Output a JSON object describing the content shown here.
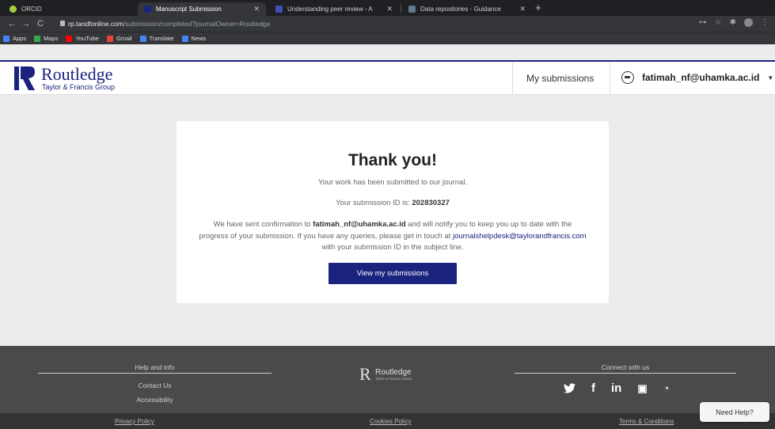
{
  "browser": {
    "tabs": [
      {
        "title": "ORCID",
        "favicon_color": "#a6ce39"
      },
      {
        "title": "Manuscript Submission",
        "favicon_color": "#1a237e"
      },
      {
        "title": "Understanding peer review - A",
        "favicon_color": "#3f51b5"
      },
      {
        "title": "Data repositories - Guidance",
        "favicon_color": "#607d8b"
      }
    ],
    "url_host": "rp.tandfonline.com",
    "url_path": "/submission/completed?journalOwner=Routledge",
    "bookmarks": [
      {
        "label": "Apps",
        "color": "#4285f4"
      },
      {
        "label": "Maps",
        "color": "#34a853"
      },
      {
        "label": "YouTube",
        "color": "#ff0000"
      },
      {
        "label": "Gmail",
        "color": "#ea4335"
      },
      {
        "label": "Translate",
        "color": "#4285f4"
      },
      {
        "label": "News",
        "color": "#4285f4"
      }
    ]
  },
  "header": {
    "logo_title": "Routledge",
    "logo_subtitle": "Taylor & Francis Group",
    "my_submissions": "My submissions",
    "user_email": "fatimah_nf@uhamka.ac.id"
  },
  "card": {
    "heading": "Thank you!",
    "submitted_msg": "Your work has been submitted to our journal.",
    "submission_id_label": "Your submission ID is: ",
    "submission_id": "202830327",
    "para_1": "We have sent confirmation to ",
    "para_email": "fatimah_nf@uhamka.ac.id",
    "para_2": " and will notify you to keep you up to date with the progress of your submission. If you have any queries, please get in touch at ",
    "para_help_email": "journalshelpdesk@taylorandfrancis.com",
    "para_3": " with your submission ID in the subject line.",
    "button": "View my submissions"
  },
  "footer": {
    "help_heading": "Help and info",
    "contact": "Contact Us",
    "accessibility": "Accessibility",
    "logo_title": "Routledge",
    "logo_sub": "Taylor & Francis Group",
    "connect_heading": "Connect with us",
    "privacy": "Privacy Policy",
    "cookies": "Cookies Policy",
    "terms": "Terms & Conditions"
  },
  "need_help": "Need Help?",
  "colors": {
    "brand": "#1a237e",
    "footer": "#4a4a4a"
  }
}
